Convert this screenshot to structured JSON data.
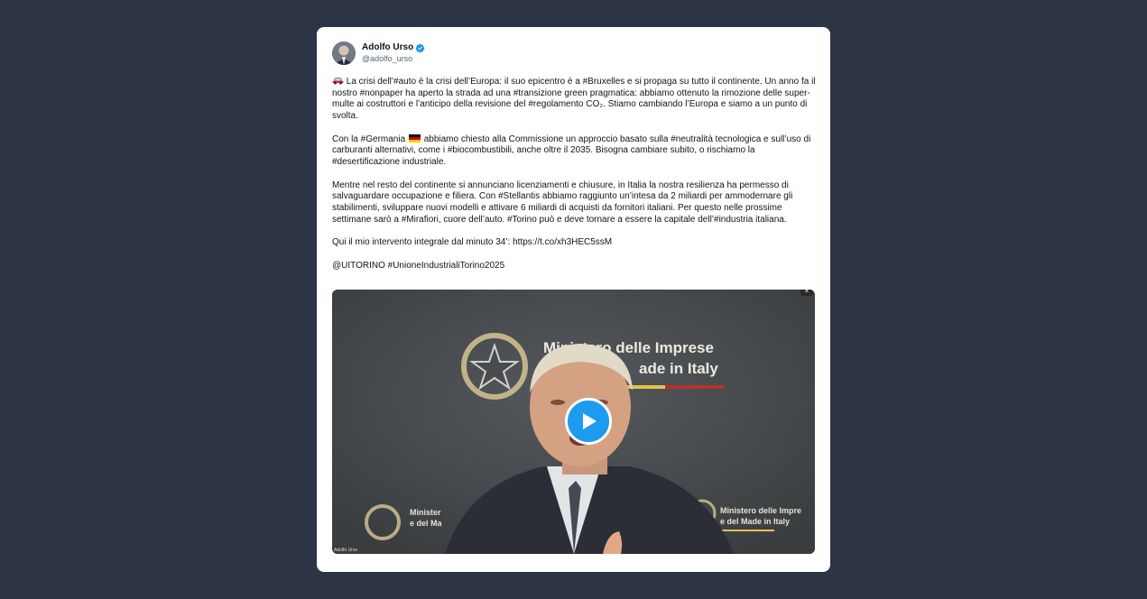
{
  "tweet": {
    "display_name": "Adolfo Urso",
    "handle": "@adolfo_urso",
    "paragraphs": {
      "p1": " La crisi dell’#auto è la crisi dell’Europa: il suo epicentro è a #Bruxelles e si propaga su tutto il continente. Un anno fa il nostro #nonpaper ha aperto la strada ad una #transizione green pragmatica: abbiamo ottenuto la rimozione delle super-multe ai costruttori e l’anticipo della revisione del #regolamento CO₂. Stiamo cambiando l’Europa e siamo a un punto di svolta.",
      "p2a": "Con la #Germania ",
      "p2b": " abbiamo chiesto alla Commissione un approccio basato sulla #neutralità tecnologica e sull’uso di carburanti alternativi, come i #biocombustibili, anche oltre il 2035. Bisogna cambiare subito, o rischiamo la #desertificazione industriale.",
      "p3": "Mentre nel resto del continente si annunciano licenziamenti e chiusure, in Italia la nostra resilienza ha permesso di salvaguardare occupazione e filiera. Con #Stellantis abbiamo raggiunto un’intesa da 2 miliardi per ammodernare gli stabilimenti, sviluppare nuovi modelli e attivare 6 miliardi di acquisti da fornitori italiani. Per questo nelle prossime settimane sarò a #Mirafiori, cuore dell’auto. #Torino può e deve tornare a essere la capitale dell’#industria italiana.",
      "p4": "Qui il mio intervento integrale dal minuto 34’: https://t.co/xh3HEC5ssM",
      "p5": "@UITORINO #UnioneIndustrialiTorino2025"
    },
    "emoji": {
      "car": "car-icon",
      "flag": "germany-flag-icon"
    },
    "video": {
      "sign_top_line1": "Ministero delle Imprese",
      "sign_top_line2": "ade in Italy",
      "sign_left_line1": "Minister",
      "sign_left_line2": "e del Ma",
      "sign_right_line1": "Ministero delle Impre",
      "sign_right_line2": "e del Made in Italy",
      "watermark": "Adolfo Urso",
      "close_glyph": "×"
    }
  },
  "colors": {
    "page_bg": "#2d3445",
    "card_bg": "#ffffff",
    "verified_blue": "#1d9bf0",
    "play_blue": "#1d9bf0",
    "flag_black": "#000000",
    "flag_red": "#dd0000",
    "flag_gold": "#ffce00"
  }
}
